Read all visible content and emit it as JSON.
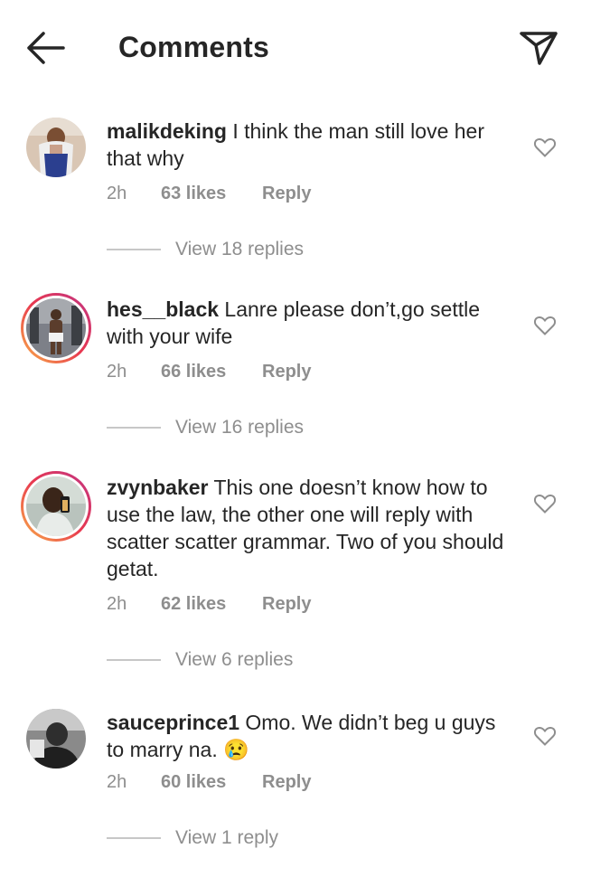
{
  "header": {
    "title": "Comments",
    "back_icon": "arrow-left-icon",
    "share_icon": "paper-plane-icon"
  },
  "colors": {
    "text": "#262626",
    "secondary": "#8e8e8e",
    "ring_start": "#f9b147",
    "ring_end": "#c13584"
  },
  "comments": [
    {
      "username": "malikdeking",
      "text": " I think the man still love her that why",
      "time": "2h",
      "likes": "63 likes",
      "reply": "Reply",
      "view_replies": "View 18 replies",
      "has_story_ring": false
    },
    {
      "username": "hes__black",
      "text": " Lanre please don’t,go settle with your wife",
      "time": "2h",
      "likes": "66 likes",
      "reply": "Reply",
      "view_replies": "View 16 replies",
      "has_story_ring": true
    },
    {
      "username": "zvynbaker",
      "text": " This one doesn’t know how to use the law, the other one will reply with scatter scatter grammar. Two of you should getat.",
      "time": "2h",
      "likes": "62 likes",
      "reply": "Reply",
      "view_replies": "View 6 replies",
      "has_story_ring": true
    },
    {
      "username": "sauceprince1",
      "text": " Omo. We didn’t beg u guys to marry na. 😢",
      "time": "2h",
      "likes": "60 likes",
      "reply": "Reply",
      "view_replies": "View 1 reply",
      "has_story_ring": false
    }
  ]
}
